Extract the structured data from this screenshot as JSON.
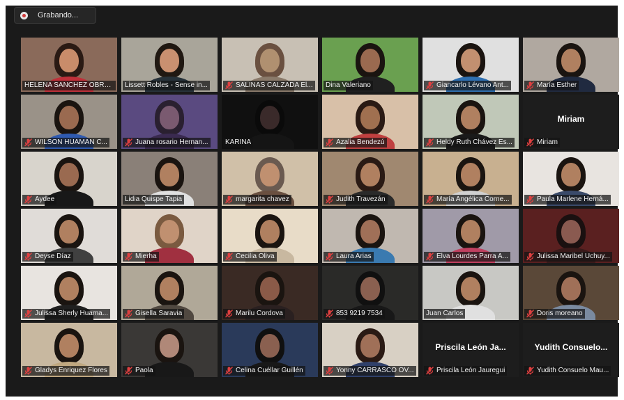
{
  "recording": {
    "label": "Grabando...",
    "icon": "record-icon"
  },
  "colors": {
    "active_speaker": "#c9d66a",
    "muted_mic": "#e04040"
  },
  "participants": [
    {
      "name": "HELENA SANCHEZ OBRE...",
      "muted": false,
      "video": true,
      "bg": "#8a6a5a",
      "skin": "#c98c6a",
      "hair": "#2a1a14",
      "shirt": "#c0303a"
    },
    {
      "name": "Lissett Robles - Sense in...",
      "muted": false,
      "video": true,
      "active": true,
      "bg": "#a9a59a",
      "skin": "#c99070",
      "hair": "#201812",
      "shirt": "#27323a"
    },
    {
      "name": "SALINAS CALZADA El...",
      "muted": true,
      "video": true,
      "bg": "#c8c0b4",
      "skin": "#b09070",
      "hair": "#6a5040",
      "shirt": "#8a7a6a"
    },
    {
      "name": "Dina Valeriano",
      "muted": false,
      "video": true,
      "bg": "#6aa050",
      "skin": "#9a6a50",
      "hair": "#1a1410",
      "shirt": "#202020"
    },
    {
      "name": "Giancarlo Lévano Ant...",
      "muted": true,
      "video": true,
      "bg": "#e0e0e0",
      "skin": "#c29070",
      "hair": "#1a1410",
      "shirt": "#2f6fb0"
    },
    {
      "name": "María Esther",
      "muted": true,
      "video": true,
      "bg": "#b0a8a0",
      "skin": "#b08060",
      "hair": "#1a1410",
      "shirt": "#202a40"
    },
    {
      "name": "WILSON HUAMAN C...",
      "muted": true,
      "video": true,
      "bg": "#9a9288",
      "skin": "#9a6a50",
      "hair": "#1a1410",
      "shirt": "#2f5ab0"
    },
    {
      "name": "Juana rosario Hernan...",
      "muted": true,
      "video": true,
      "bg": "#5a4a80",
      "skin": "#7a5a70",
      "hair": "#2a2030",
      "shirt": "#3a2a50"
    },
    {
      "name": "KARINA",
      "muted": false,
      "video": true,
      "bg": "#101010",
      "skin": "#3a2a2a",
      "hair": "#0a0a0a",
      "shirt": "#151515"
    },
    {
      "name": "Azalia Bendezú",
      "muted": true,
      "video": true,
      "bg": "#d8c0a8",
      "skin": "#a07050",
      "hair": "#2a1a14",
      "shirt": "#c04040"
    },
    {
      "name": "Heldy Ruth Chávez Es...",
      "muted": true,
      "video": true,
      "bg": "#c0c8b8",
      "skin": "#b08060",
      "hair": "#1a1410",
      "shirt": "#1a1a1a"
    },
    {
      "name": "Miriam",
      "muted": true,
      "video": false,
      "display": "Miriam"
    },
    {
      "name": "Aydee",
      "muted": true,
      "video": true,
      "bg": "#d8d4cc",
      "skin": "#9a6a50",
      "hair": "#1a1410",
      "shirt": "#181818"
    },
    {
      "name": "Lidia Quispe Tapia",
      "muted": false,
      "video": true,
      "bg": "#8a8078",
      "skin": "#b08060",
      "hair": "#1a1410",
      "shirt": "#e0e0e0"
    },
    {
      "name": "margarita chavez",
      "muted": true,
      "video": true,
      "bg": "#d0c0a8",
      "skin": "#c09070",
      "hair": "#6a5a50",
      "shirt": "#6a5040"
    },
    {
      "name": "Judith Travezán",
      "muted": true,
      "video": true,
      "bg": "#a08870",
      "skin": "#b08060",
      "hair": "#2a1a14",
      "shirt": "#2a2a2a"
    },
    {
      "name": "María Angélica Corne...",
      "muted": true,
      "video": true,
      "bg": "#c8b090",
      "skin": "#b08060",
      "hair": "#1a1410",
      "shirt": "#d0d0d0"
    },
    {
      "name": "Paula Marlene Herná...",
      "muted": true,
      "video": true,
      "bg": "#e8e4e0",
      "skin": "#b08060",
      "hair": "#1a1410",
      "shirt": "#3a4a6a"
    },
    {
      "name": "Deyse Díaz",
      "muted": true,
      "video": true,
      "bg": "#e0dcd8",
      "skin": "#b08060",
      "hair": "#1a1410",
      "shirt": "#404040"
    },
    {
      "name": "Mierha",
      "muted": true,
      "video": true,
      "bg": "#e0d4c8",
      "skin": "#c09070",
      "hair": "#7a5a40",
      "shirt": "#a03040"
    },
    {
      "name": "Cecilia Oliva",
      "muted": true,
      "video": true,
      "bg": "#e8dcc8",
      "skin": "#b08060",
      "hair": "#1a1410",
      "shirt": "#c8b8a0"
    },
    {
      "name": "Laura Arias",
      "muted": true,
      "video": true,
      "bg": "#c0b8b0",
      "skin": "#a07058",
      "hair": "#1a1410",
      "shirt": "#3a7ab0"
    },
    {
      "name": "Elva Lourdes Parra A...",
      "muted": true,
      "video": true,
      "bg": "#a09aa8",
      "skin": "#b08060",
      "hair": "#1a1410",
      "shirt": "#c04060"
    },
    {
      "name": "Julissa Maribel Uchuy...",
      "muted": true,
      "video": true,
      "bg": "#5a2020",
      "skin": "#8a5a50",
      "hair": "#1a1010",
      "shirt": "#3a1a1a"
    },
    {
      "name": "Julissa Sherly Huama...",
      "muted": true,
      "video": true,
      "bg": "#e8e4e0",
      "skin": "#b08060",
      "hair": "#1a1410",
      "shirt": "#202020"
    },
    {
      "name": "Gisella Saravia",
      "muted": true,
      "video": true,
      "bg": "#b0a898",
      "skin": "#b08060",
      "hair": "#1a1410",
      "shirt": "#504840"
    },
    {
      "name": "Marilu Cordova",
      "muted": true,
      "video": true,
      "bg": "#3a2a24",
      "skin": "#8a5a48",
      "hair": "#1a1410",
      "shirt": "#2a2020"
    },
    {
      "name": "853 9219 7534",
      "muted": true,
      "video": true,
      "bg": "#2a2a28",
      "skin": "#8a6050",
      "hair": "#101010",
      "shirt": "#181818"
    },
    {
      "name": "Juan Carlos",
      "muted": false,
      "video": true,
      "bg": "#c8c8c4",
      "skin": "#b08060",
      "hair": "#1a1410",
      "shirt": "#e0e0e0"
    },
    {
      "name": "Doris moreano",
      "muted": true,
      "video": true,
      "bg": "#5a4838",
      "skin": "#a07058",
      "hair": "#1a1410",
      "shirt": "#7a8aa0"
    },
    {
      "name": "Gladys Enriquez Flores",
      "muted": true,
      "video": true,
      "bg": "#c8b8a0",
      "skin": "#b08060",
      "hair": "#1a1410",
      "shirt": "#c0a880"
    },
    {
      "name": "Paola",
      "muted": true,
      "video": true,
      "bg": "#3a3836",
      "skin": "#b08878",
      "hair": "#1a1410",
      "shirt": "#181818"
    },
    {
      "name": "Celina Cuéllar Guillén",
      "muted": true,
      "video": true,
      "bg": "#2a3a5a",
      "skin": "#8a6050",
      "hair": "#101010",
      "shirt": "#181818"
    },
    {
      "name": "Yonny CARRASCO OV...",
      "muted": true,
      "video": true,
      "bg": "#d8d0c4",
      "skin": "#a07058",
      "hair": "#2a1a14",
      "shirt": "#30406a"
    },
    {
      "name": "Priscila León Jauregui",
      "muted": true,
      "video": false,
      "display": "Priscila León Ja..."
    },
    {
      "name": "Yudith Consuelo Mau...",
      "muted": true,
      "video": false,
      "display": "Yudith Consuelo..."
    }
  ]
}
